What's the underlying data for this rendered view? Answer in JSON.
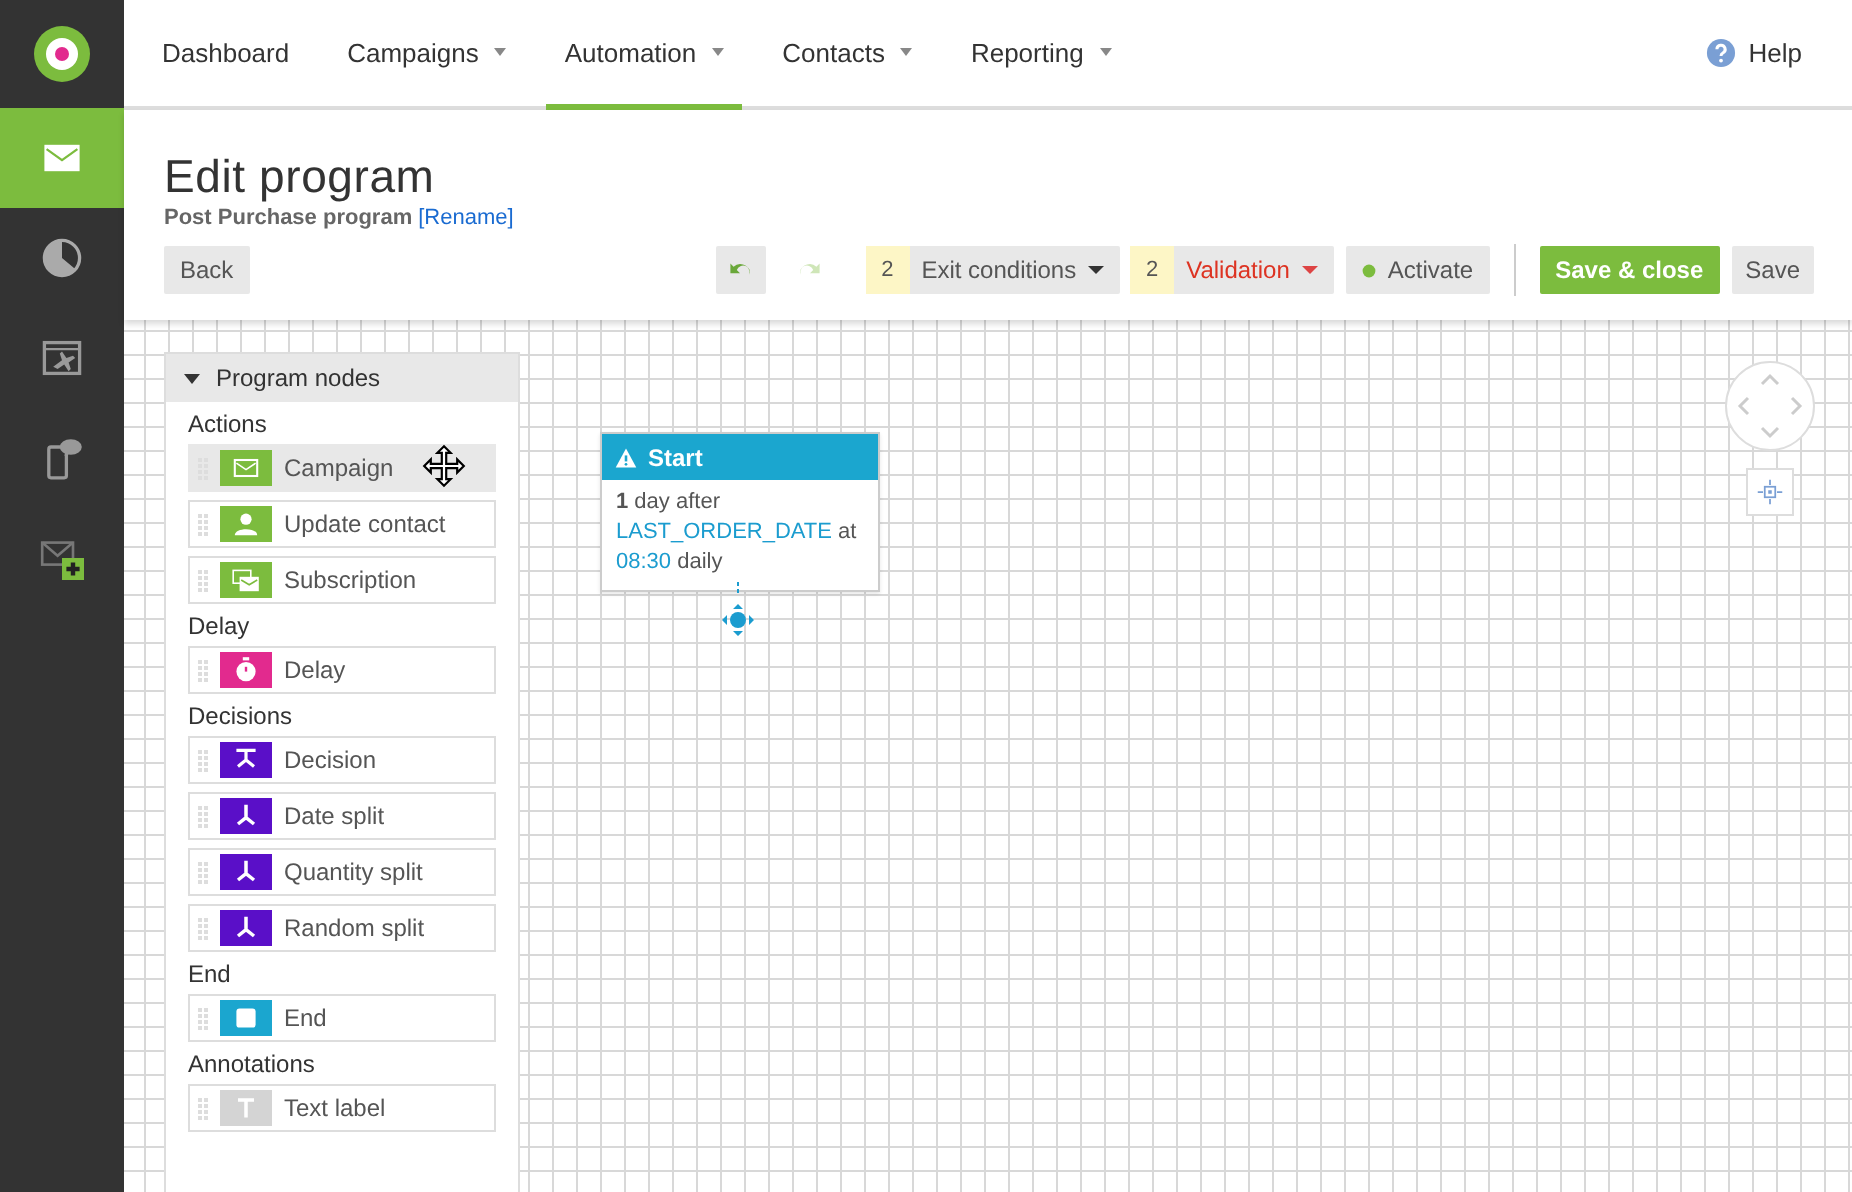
{
  "sidebar": {
    "items": [
      {
        "kind": "mail",
        "selected": true
      },
      {
        "kind": "pie",
        "selected": false
      },
      {
        "kind": "browser-plane",
        "selected": false
      },
      {
        "kind": "phone-chat",
        "selected": false
      },
      {
        "kind": "mail-plus",
        "selected": false
      }
    ]
  },
  "nav": {
    "items": [
      {
        "label": "Dashboard",
        "dropdown": false,
        "selected": false
      },
      {
        "label": "Campaigns",
        "dropdown": true,
        "selected": false
      },
      {
        "label": "Automation",
        "dropdown": true,
        "selected": true
      },
      {
        "label": "Contacts",
        "dropdown": true,
        "selected": false
      },
      {
        "label": "Reporting",
        "dropdown": true,
        "selected": false
      }
    ],
    "help": "Help"
  },
  "header": {
    "title": "Edit program",
    "program_name": "Post Purchase program",
    "rename_link": "[Rename]"
  },
  "toolbar": {
    "back": "Back",
    "undo": {
      "disabled": false
    },
    "redo": {
      "disabled": true
    },
    "exit_conditions": {
      "count": "2",
      "label": "Exit conditions"
    },
    "validation": {
      "count": "2",
      "label": "Validation"
    },
    "activate": "Activate",
    "save_close": "Save & close",
    "save": "Save"
  },
  "palette": {
    "title": "Program nodes",
    "expanded": true,
    "groups": [
      {
        "heading": "Actions",
        "items": [
          {
            "label": "Campaign",
            "kind": "mail",
            "color": "#7cbc3e",
            "selected": true
          },
          {
            "label": "Update contact",
            "kind": "person",
            "color": "#7cbc3e",
            "selected": false
          },
          {
            "label": "Subscription",
            "kind": "envelopes",
            "color": "#7cbc3e",
            "selected": false
          }
        ]
      },
      {
        "heading": "Delay",
        "items": [
          {
            "label": "Delay",
            "kind": "stopwatch",
            "color": "#e22a8e",
            "selected": false
          }
        ]
      },
      {
        "heading": "Decisions",
        "items": [
          {
            "label": "Decision",
            "kind": "decision",
            "color": "#5a0fc8",
            "selected": false
          },
          {
            "label": "Date split",
            "kind": "split",
            "color": "#5a0fc8",
            "selected": false
          },
          {
            "label": "Quantity split",
            "kind": "split",
            "color": "#5a0fc8",
            "selected": false
          },
          {
            "label": "Random split",
            "kind": "split",
            "color": "#5a0fc8",
            "selected": false
          }
        ]
      },
      {
        "heading": "End",
        "items": [
          {
            "label": "End",
            "kind": "square",
            "color": "#1ba6cf",
            "selected": false
          }
        ]
      },
      {
        "heading": "Annotations",
        "items": [
          {
            "label": "Text label",
            "kind": "text",
            "color": "#d4d4d4",
            "selected": false
          }
        ]
      }
    ]
  },
  "canvas": {
    "start_node": {
      "title": "Start",
      "description": [
        {
          "text": "1",
          "kind": "number"
        },
        {
          "text": " day after ",
          "kind": "plain"
        },
        {
          "text": "LAST_ORDER_DATE",
          "kind": "value"
        },
        {
          "text": " at ",
          "kind": "plain"
        },
        {
          "text": "08:30",
          "kind": "value"
        },
        {
          "text": " daily",
          "kind": "plain"
        }
      ]
    }
  }
}
